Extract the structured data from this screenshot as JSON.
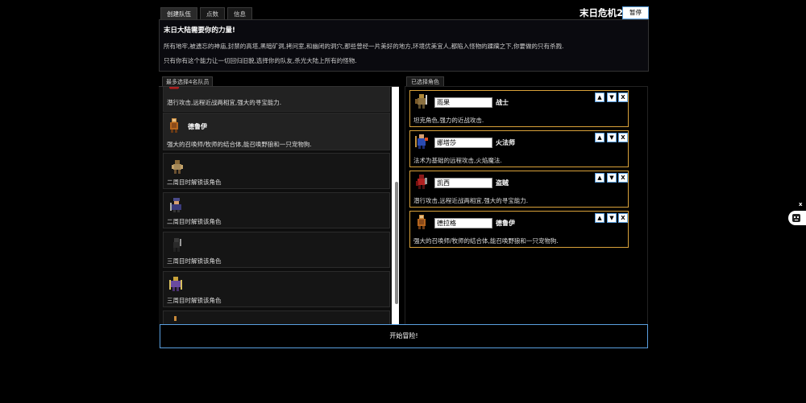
{
  "tabs": [
    {
      "label": "创建队伍",
      "active": true
    },
    {
      "label": "点数",
      "active": false
    },
    {
      "label": "信息",
      "active": false
    }
  ],
  "game_title": "末日危机2",
  "pause_label": "暂停",
  "intro": {
    "title": "末日大陆需要你的力量!",
    "p1": "所有地牢,被遗忘的神庙,封禁的高塔,黑暗矿洞,拷问室,和幽闭的洞穴,那些曾经一片美好的地方,环境优美宜人,都陷入怪物的蹂躏之下,你要做的只有杀戮.",
    "p2": "只有你有这个能力让一切回归旧貌,选择你的队友,杀光大陆上所有的怪物."
  },
  "left_header": "最多选择4名队员",
  "right_header": "已选择角色",
  "available": [
    {
      "name": "",
      "desc": "潜行攻击,远程近战两相宜,强大的寻宝能力.",
      "icon": "rogue-sprite-icon"
    },
    {
      "name": "德鲁伊",
      "desc": "强大的召唤师/牧师的结合体,能召唤野狼和一只宠物狗.",
      "icon": "druid-sprite-icon"
    },
    {
      "name": "",
      "desc": "二周目时解锁该角色",
      "icon": "locked-sprite-icon"
    },
    {
      "name": "",
      "desc": "二周目时解锁该角色",
      "icon": "locked-sprite-icon"
    },
    {
      "name": "",
      "desc": "三周目时解锁该角色",
      "icon": "locked-sprite-icon"
    },
    {
      "name": "",
      "desc": "三周目时解锁该角色",
      "icon": "locked-sprite-icon"
    }
  ],
  "selected": [
    {
      "name_value": "雨果",
      "class": "战士",
      "desc": "坦克角色,强力的近战攻击.",
      "icon": "warrior-sprite-icon"
    },
    {
      "name_value": "娜塔莎",
      "class": "火法师",
      "desc": "法术为基础的远程攻击,火焰魔法.",
      "icon": "fire-mage-sprite-icon"
    },
    {
      "name_value": "凯西",
      "class": "盗贼",
      "desc": "潜行攻击,远程近战两相宜,强大的寻宝能力.",
      "icon": "rogue-sprite-icon"
    },
    {
      "name_value": "德拉格",
      "class": "德鲁伊",
      "desc": "强大的召唤师/牧师的结合体,能召唤野狼和一只宠物狗.",
      "icon": "druid-sprite-icon"
    }
  ],
  "controls": {
    "up": "▲",
    "down": "▼",
    "remove": "X"
  },
  "start_label": "开始冒险!",
  "side_close": "x",
  "colors": {
    "selected_border": "#d9a23a",
    "button_border": "#5aa0e0"
  }
}
